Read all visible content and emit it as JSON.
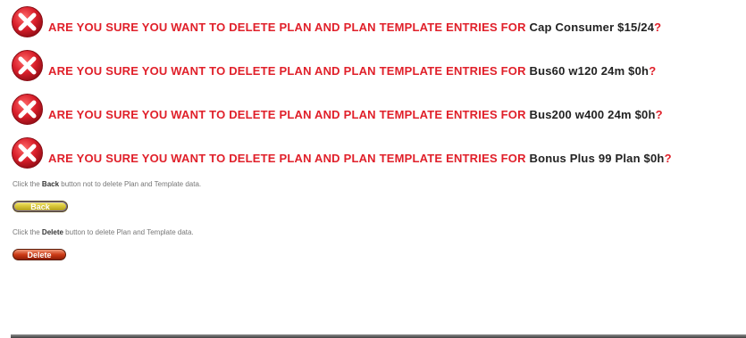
{
  "warnings": [
    {
      "lead": "Are you sure you want to delete Plan and Plan Template entries for",
      "plan": "Cap Consumer $15/24",
      "suffix": "?"
    },
    {
      "lead": "Are you sure you want to delete Plan and Plan Template entries for",
      "plan": "Bus60 w120 24m $0h",
      "suffix": "?"
    },
    {
      "lead": "Are you sure you want to delete Plan and Plan Template entries for",
      "plan": "Bus200 w400 24m $0h",
      "suffix": "?"
    },
    {
      "lead": "Are you sure you want to delete Plan and Plan Template entries for",
      "plan": "Bonus Plus 99 Plan $0h",
      "suffix": "?"
    }
  ],
  "back_info": {
    "prefix": "Click the",
    "button_word": "Back",
    "suffix": "button not to delete Plan and Template data."
  },
  "back_button": {
    "label": "Back"
  },
  "delete_info": {
    "prefix": "Click the",
    "button_word": "Delete",
    "suffix": "button to delete Plan and Template data."
  },
  "delete_button": {
    "label": "Delete"
  },
  "colors": {
    "warning_red": "#e0202a",
    "icon_red": "#d81e2a",
    "back_button": "#d9c737",
    "delete_button": "#cc3a16"
  },
  "icons": {
    "warning": "error-x-circle-icon"
  }
}
